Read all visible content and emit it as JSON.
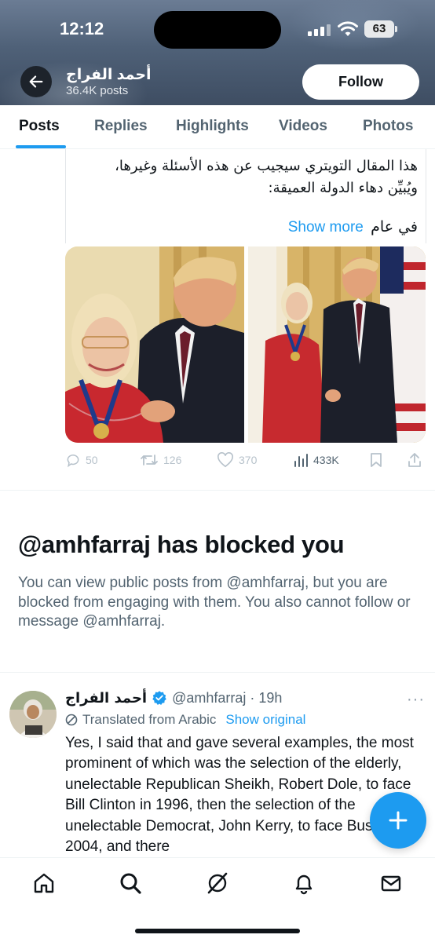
{
  "status_bar": {
    "time": "12:12",
    "battery": "63"
  },
  "header": {
    "name": "أحمد الفراج",
    "post_count": "36.4K posts",
    "follow_label": "Follow"
  },
  "tabs": [
    {
      "label": "Posts",
      "active": true
    },
    {
      "label": "Replies",
      "active": false
    },
    {
      "label": "Highlights",
      "active": false
    },
    {
      "label": "Videos",
      "active": false
    },
    {
      "label": "Photos",
      "active": false
    }
  ],
  "tweet1": {
    "text_line1": "هذا المقال التويتري سيجيب عن هذه الأسئلة وغيرها،",
    "text_line2": "ويُبيِّن دهاء الدولة العميقة:",
    "text_line3": "في عام",
    "show_more": "Show more",
    "stats": {
      "replies": "50",
      "reposts": "126",
      "likes": "370",
      "views": "433K"
    }
  },
  "blocked": {
    "title": "@amhfarraj has blocked you",
    "body": "You can view public posts from @amhfarraj, but you are blocked from engaging with them. You also cannot follow or message @amhfarraj."
  },
  "tweet2": {
    "name": "أحمد الفراج",
    "handle_time": "@amhfarraj · 19h",
    "translated_label": "Translated from Arabic",
    "show_original": "Show original",
    "text": "Yes, I said that and gave several examples, the most prominent of which was the selection of the elderly, unelectable Republican Sheikh, Robert Dole, to face Bill Clinton in 1996, then the selection of the unelectable Democrat, John Kerry, to face Bush Jr. in 2004, and there"
  },
  "colors": {
    "accent": "#1d9bf0",
    "text_primary": "#0f1419",
    "text_secondary": "#536471"
  },
  "icons": {
    "back": "arrow-left-icon",
    "verified": "verified-badge-icon",
    "compose": "plus-icon",
    "nav": [
      "home-icon",
      "search-icon",
      "grok-icon",
      "bell-icon",
      "mail-icon"
    ]
  }
}
